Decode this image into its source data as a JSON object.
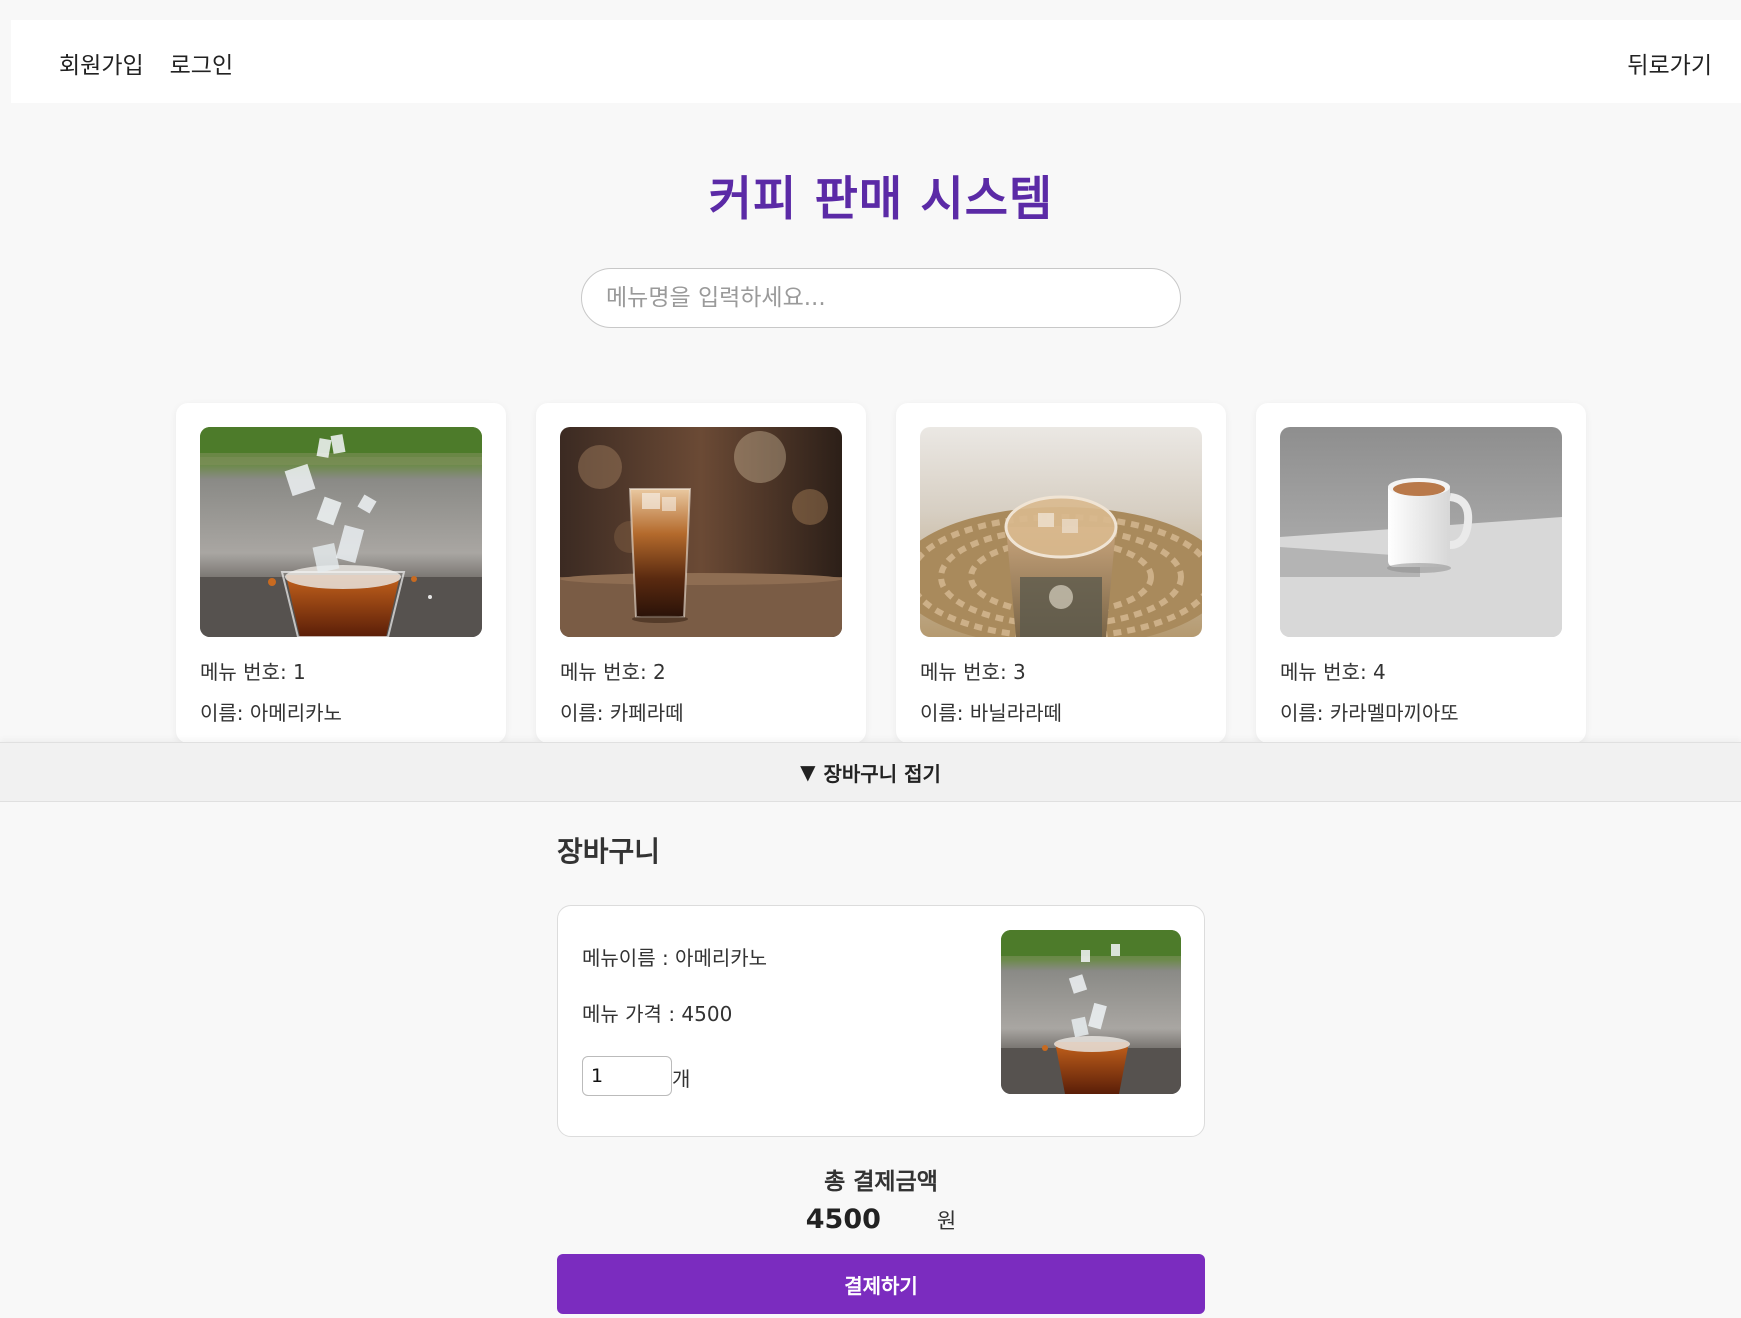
{
  "header": {
    "signup_label": "회원가입",
    "login_label": "로그인",
    "back_label": "뒤로가기"
  },
  "page_title": "커피 판매 시스템",
  "search": {
    "placeholder": "메뉴명을 입력하세요...",
    "value": ""
  },
  "menu_cards": [
    {
      "number_text": "메뉴 번호: 1",
      "name_text": "이름: 아메리카노",
      "image": "iced-americano-photo"
    },
    {
      "number_text": "메뉴 번호: 2",
      "name_text": "이름: 카페라떼",
      "image": "cafe-latte-photo"
    },
    {
      "number_text": "메뉴 번호: 3",
      "name_text": "이름: 바닐라라떼",
      "image": "vanilla-latte-photo"
    },
    {
      "number_text": "메뉴 번호: 4",
      "name_text": "이름: 카라멜마끼아또",
      "image": "caramel-macchiato-photo"
    }
  ],
  "cart_toggle": {
    "arrow": "▼",
    "label": "장바구니 접기"
  },
  "cart": {
    "title": "장바구니",
    "items": [
      {
        "name_text": "메뉴이름 : 아메리카노",
        "price_text": "메뉴 가격 : 4500",
        "quantity": "1",
        "unit": "개",
        "image": "iced-americano-photo"
      }
    ],
    "total_label": "총 결제금액",
    "total_amount": "4500",
    "total_unit": "원",
    "pay_label": "결제하기"
  },
  "colors": {
    "title": "#5b2aa6",
    "pay_button": "#7b2cbf",
    "background": "#f8f8f8"
  }
}
